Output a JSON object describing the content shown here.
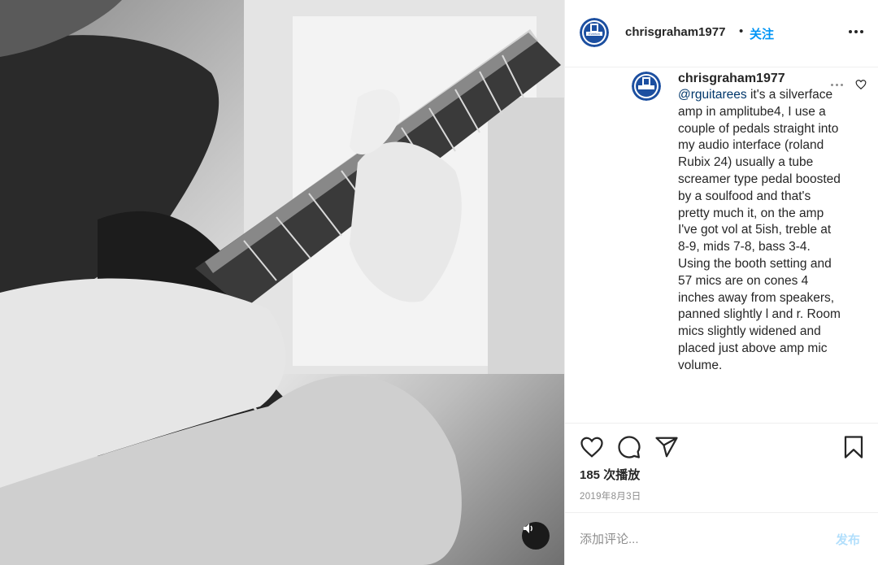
{
  "post": {
    "username": "chrisgraham1977",
    "separator": "•",
    "follow_label": "关注",
    "avatar_icon": "everton-crest-icon",
    "avatar_text": "Everton"
  },
  "comment": {
    "username": "chrisgraham1977",
    "mention": "@rguitarees",
    "text": " it's a silverface amp in amplitube4, I use a couple of pedals straight into my audio interface (roland Rubix 24) usually a tube screamer type pedal boosted by a soulfood and that's pretty much it, on the amp I've got vol at 5ish, treble at 8-9, mids 7-8, bass 3-4. Using the booth setting and 57 mics are on cones 4 inches away from speakers, panned slightly l and r. Room mics slightly widened and placed just above amp mic volume."
  },
  "stats": {
    "views": "185 次播放",
    "date": "2019年8月3日"
  },
  "add_comment": {
    "placeholder": "添加评论...",
    "post_label": "发布"
  },
  "icons": [
    "heart-icon",
    "comment-icon",
    "share-icon",
    "bookmark-icon",
    "more-icon",
    "speaker-icon"
  ],
  "colors": {
    "accent": "#0095f6",
    "text": "#262626",
    "secondary": "#8e8e8e",
    "mention": "#00376b",
    "post_disabled": "#b2dffc",
    "crest_blue": "#1c4fa0"
  }
}
